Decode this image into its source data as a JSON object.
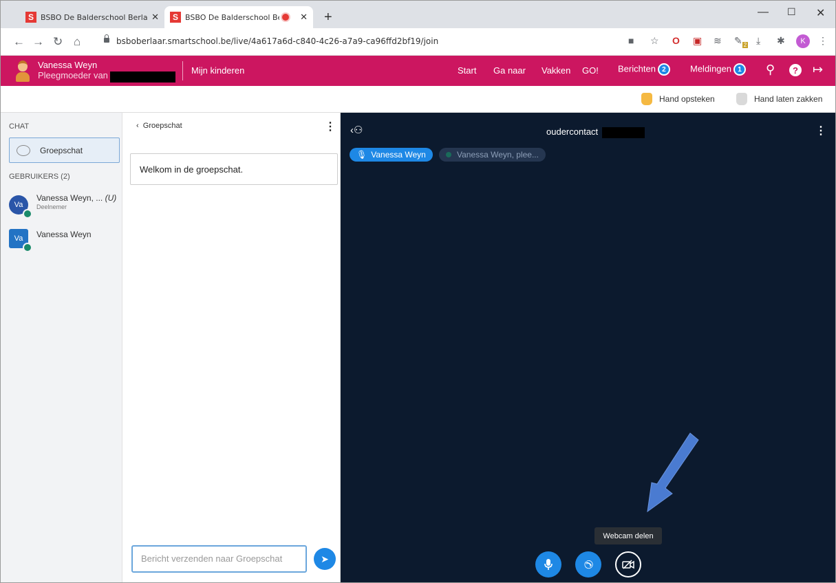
{
  "browser": {
    "tabs": [
      {
        "title": "BSBO De Balderschool Berlaar - S",
        "active": false
      },
      {
        "title": "BSBO De Balderschool Berlaa",
        "active": true,
        "recording": true
      }
    ],
    "url": "bsboberlaar.smartschool.be/live/4a617a6d-c840-4c26-a7a9-ca96ffd2bf19/join",
    "profile_initial": "K",
    "extension_badge": "2"
  },
  "header": {
    "user_name": "Vanessa Weyn",
    "user_role": "Pleegmoeder van",
    "kids_link": "Mijn kinderen",
    "nav": [
      "Start",
      "Ga naar",
      "Vakken",
      "GO!"
    ],
    "berichten": {
      "label": "Berichten",
      "count": "2"
    },
    "meldingen": {
      "label": "Meldingen",
      "count": "1"
    }
  },
  "toolbar": {
    "raise_hand": "Hand opsteken",
    "lower_hand": "Hand laten zakken"
  },
  "sidebar": {
    "chat_heading": "CHAT",
    "group_chat": "Groepschat",
    "users_heading": "GEBRUIKERS (2)",
    "users": [
      {
        "initials": "Va",
        "name": "Vanessa Weyn, ...",
        "suffix": "(U)",
        "role": "Deelnemer"
      },
      {
        "initials": "Va",
        "name": "Vanessa Weyn"
      }
    ]
  },
  "chat": {
    "back_label": "Groepschat",
    "welcome": "Welkom in de groepschat.",
    "input_placeholder": "Bericht verzenden naar Groepschat"
  },
  "video": {
    "title": "oudercontact",
    "participants": [
      "Vanessa Weyn",
      "Vanessa Weyn, plee..."
    ],
    "tooltip": "Webcam delen"
  },
  "colors": {
    "brand": "#cc1660",
    "accent": "#1e88e5",
    "video_bg": "#0c1a2e"
  }
}
